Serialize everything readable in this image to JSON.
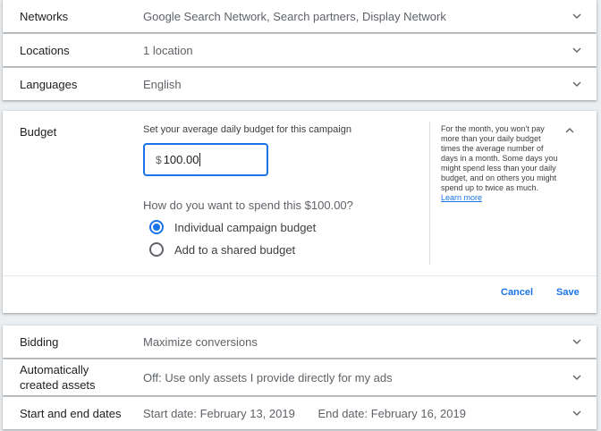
{
  "rows_top": [
    {
      "label": "Networks",
      "value": "Google Search Network, Search partners, Display Network"
    },
    {
      "label": "Locations",
      "value": "1 location"
    },
    {
      "label": "Languages",
      "value": "English"
    }
  ],
  "budget": {
    "label": "Budget",
    "prompt": "Set your average daily budget for this campaign",
    "currency": "$",
    "amount": "100.00",
    "question": "How do you want to spend this $100.00?",
    "options": [
      {
        "label": "Individual campaign budget",
        "selected": true
      },
      {
        "label": "Add to a shared budget",
        "selected": false
      }
    ],
    "help_text": "For the month, you won't pay more than your daily budget times the average number of days in a month. Some days you might spend less than your daily budget, and on others you might spend up to twice as much.",
    "learn_more": "Learn more",
    "cancel_label": "Cancel",
    "save_label": "Save"
  },
  "rows_bottom": {
    "bidding": {
      "label": "Bidding",
      "value": "Maximize conversions"
    },
    "assets": {
      "label_line1": "Automatically",
      "label_line2": "created assets",
      "value": "Off: Use only assets I provide directly for my ads"
    },
    "dates": {
      "label": "Start and end dates",
      "start": "Start date: February 13, 2019",
      "end": "End date: February 16, 2019"
    }
  },
  "colors": {
    "accent": "#1a73e8",
    "background": "#eceff1",
    "card": "#ffffff"
  }
}
